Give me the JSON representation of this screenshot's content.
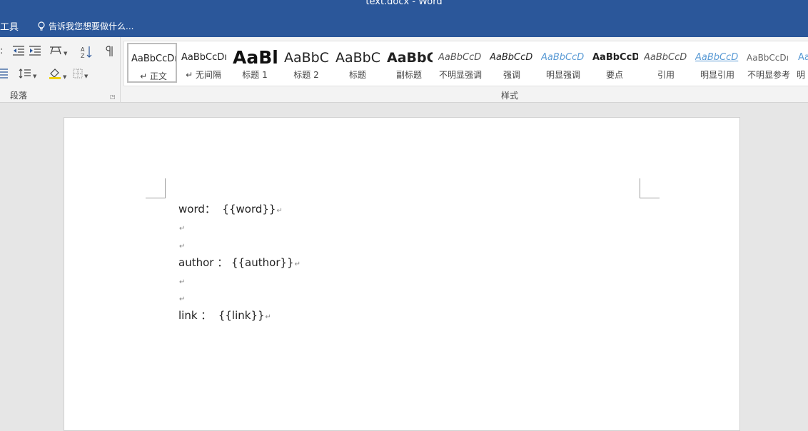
{
  "window": {
    "title": "text.docx - Word"
  },
  "tabrow": {
    "tool_label": "工具",
    "tell_me": "告诉我您想要做什么..."
  },
  "ribbon": {
    "paragraph_group_label": "段落",
    "styles_group_label": "样式",
    "styles": [
      {
        "preview": "AaBbCcDı",
        "name": "↵ 正文"
      },
      {
        "preview": "AaBbCcDı",
        "name": "↵ 无间隔"
      },
      {
        "preview": "AaBl",
        "name": "标题 1"
      },
      {
        "preview": "AaBbC",
        "name": "标题 2"
      },
      {
        "preview": "AaBbC",
        "name": "标题"
      },
      {
        "preview": "AaBbC",
        "name": "副标题"
      },
      {
        "preview": "AaBbCcD",
        "name": "不明显强调"
      },
      {
        "preview": "AaBbCcD",
        "name": "强调"
      },
      {
        "preview": "AaBbCcD",
        "name": "明显强调"
      },
      {
        "preview": "AaBbCcD",
        "name": "要点"
      },
      {
        "preview": "AaBbCcD",
        "name": "引用"
      },
      {
        "preview": "AaBbCcD",
        "name": "明显引用"
      },
      {
        "preview": "AaBbCcDı",
        "name": "不明显参考"
      },
      {
        "preview": "AaB",
        "name": "明"
      }
    ]
  },
  "document": {
    "lines": [
      "word：  {{word}}",
      "",
      "",
      "author ： {{author}}",
      "",
      "",
      "link ：  {{link}}"
    ],
    "paragraph_mark": "↵"
  },
  "colors": {
    "title_bar": "#2b579a",
    "ribbon_bg": "#f3f3f3",
    "canvas_bg": "#e6e6e6"
  }
}
